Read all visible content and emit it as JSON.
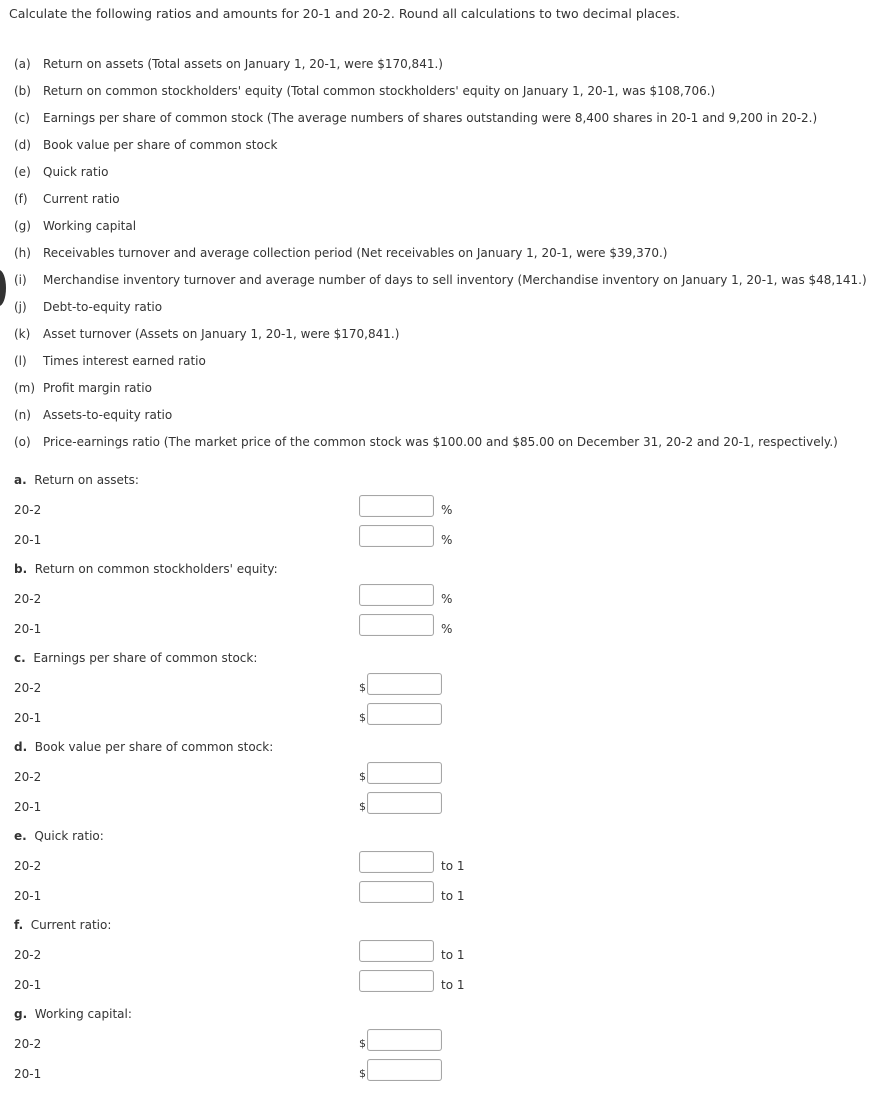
{
  "instructions": "Calculate the following ratios and amounts for 20-1 and 20-2. Round all calculations to two decimal places.",
  "requirements": [
    {
      "letter": "(a)",
      "text": "Return on assets (Total assets on January 1, 20-1, were $170,841.)"
    },
    {
      "letter": "(b)",
      "text": "Return on common stockholders' equity (Total common stockholders' equity on January 1, 20-1, was $108,706.)"
    },
    {
      "letter": "(c)",
      "text": "Earnings per share of common stock (The average numbers of shares outstanding were 8,400 shares in 20-1 and 9,200 in 20-2.)"
    },
    {
      "letter": "(d)",
      "text": "Book value per share of common stock"
    },
    {
      "letter": "(e)",
      "text": "Quick ratio"
    },
    {
      "letter": "(f)",
      "text": "Current ratio"
    },
    {
      "letter": "(g)",
      "text": "Working capital"
    },
    {
      "letter": "(h)",
      "text": "Receivables turnover and average collection period (Net receivables on January 1, 20-1, were $39,370.)"
    },
    {
      "letter": "(i)",
      "text": "Merchandise inventory turnover and average number of days to sell inventory (Merchandise inventory on January 1, 20-1, was $48,141.)"
    },
    {
      "letter": "(j)",
      "text": "Debt-to-equity ratio"
    },
    {
      "letter": "(k)",
      "text": "Asset turnover (Assets on January 1, 20-1, were $170,841.)"
    },
    {
      "letter": "(l)",
      "text": "Times interest earned ratio"
    },
    {
      "letter": "(m)",
      "text": "Profit margin ratio"
    },
    {
      "letter": "(n)",
      "text": "Assets-to-equity ratio"
    },
    {
      "letter": "(o)",
      "text": "Price-earnings ratio (The market price of the common stock was $100.00 and $85.00 on December 31, 20-2 and 20-1, respectively.)"
    }
  ],
  "sections": [
    {
      "letter": "a.",
      "title": "Return on assets:",
      "unit": "%",
      "rows": [
        {
          "year": "20-2",
          "value": ""
        },
        {
          "year": "20-1",
          "value": ""
        }
      ]
    },
    {
      "letter": "b.",
      "title": "Return on common stockholders' equity:",
      "unit": "%",
      "rows": [
        {
          "year": "20-2",
          "value": ""
        },
        {
          "year": "20-1",
          "value": ""
        }
      ]
    },
    {
      "letter": "c.",
      "title": "Earnings per share of common stock:",
      "prefix": "$",
      "rows": [
        {
          "year": "20-2",
          "value": ""
        },
        {
          "year": "20-1",
          "value": ""
        }
      ]
    },
    {
      "letter": "d.",
      "title": "Book value per share of common stock:",
      "prefix": "$",
      "rows": [
        {
          "year": "20-2",
          "value": ""
        },
        {
          "year": "20-1",
          "value": ""
        }
      ]
    },
    {
      "letter": "e.",
      "title": "Quick ratio:",
      "unit": "to 1",
      "rows": [
        {
          "year": "20-2",
          "value": ""
        },
        {
          "year": "20-1",
          "value": ""
        }
      ]
    },
    {
      "letter": "f.",
      "title": "Current ratio:",
      "unit": "to 1",
      "rows": [
        {
          "year": "20-2",
          "value": ""
        },
        {
          "year": "20-1",
          "value": ""
        }
      ]
    },
    {
      "letter": "g.",
      "title": "Working capital:",
      "prefix": "$",
      "rows": [
        {
          "year": "20-2",
          "value": ""
        },
        {
          "year": "20-1",
          "value": ""
        }
      ]
    }
  ]
}
